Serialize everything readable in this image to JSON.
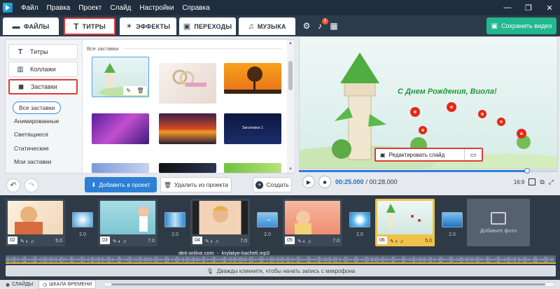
{
  "menu": {
    "items": [
      "Файл",
      "Правка",
      "Проект",
      "Слайд",
      "Настройки",
      "Справка"
    ],
    "window_controls": [
      "—",
      "❐",
      "✕"
    ]
  },
  "tabs": [
    {
      "label": "ФАЙЛЫ",
      "icon": "folder-icon"
    },
    {
      "label": "ТИТРЫ",
      "icon": "text-icon",
      "active": true
    },
    {
      "label": "ЭФФЕКТЫ",
      "icon": "sparkle-icon"
    },
    {
      "label": "ПЕРЕХОДЫ",
      "icon": "transition-icon"
    },
    {
      "label": "МУЗЫКА",
      "icon": "music-icon"
    }
  ],
  "toolbar": {
    "notification_count": "1",
    "save_label": "Сохранить видео"
  },
  "sidebar": {
    "items": [
      {
        "label": "Титры",
        "icon": "text-icon"
      },
      {
        "label": "Коллажи",
        "icon": "collage-icon"
      },
      {
        "label": "Заставки",
        "icon": "layers-icon",
        "active": true
      }
    ],
    "subitems": [
      "Все заставки",
      "Анимированные",
      "Светящиеся",
      "Статические",
      "Мои заставки"
    ],
    "selected_subitem": "Все заставки"
  },
  "gallery": {
    "title": "Все заставки",
    "thumbs": [
      {
        "label": ""
      },
      {
        "label": ""
      },
      {
        "label": ""
      },
      {
        "label": ""
      },
      {
        "label": ""
      },
      {
        "label": "Заголовок 1"
      },
      {
        "label": ""
      },
      {
        "label": ""
      },
      {
        "label": ""
      }
    ]
  },
  "actions": {
    "add_label": "Добавить в проект",
    "remove_label": "Удалить из проекта",
    "create_label": "Создать"
  },
  "preview": {
    "title_text": "С Днем Рождения, Виола!",
    "edit_slide_label": "Редактировать слайд"
  },
  "player": {
    "current_time": "00:25.000",
    "total_time": "/ 00:28.000",
    "aspect": "16:9",
    "progress": 0.88
  },
  "timeline": {
    "slides": [
      {
        "num": "02",
        "duration": "5.0"
      },
      {
        "num": "03",
        "duration": "7.0"
      },
      {
        "num": "04",
        "duration": "7.0"
      },
      {
        "num": "05",
        "duration": "7.0"
      },
      {
        "num": "06",
        "duration": "5.0",
        "active": true
      }
    ],
    "transitions": [
      "2.0",
      "2.0",
      "2.0",
      "2.0",
      "2.0"
    ],
    "add_photo_label": "Добавьте фото",
    "audio_file": "deti-online.com_-_krylatye-kacheli.mp3",
    "mic_hint": "Дважды кликните, чтобы начать запись с микрофона"
  },
  "status": {
    "slides_tab": "СЛАЙДЫ",
    "timeline_tab": "ШКАЛА ВРЕМЕНИ"
  },
  "colors": {
    "accent": "#2d7fd6",
    "save_green": "#21b88e",
    "highlight_red": "#e03a3a",
    "active_slide": "#f0c24a"
  }
}
